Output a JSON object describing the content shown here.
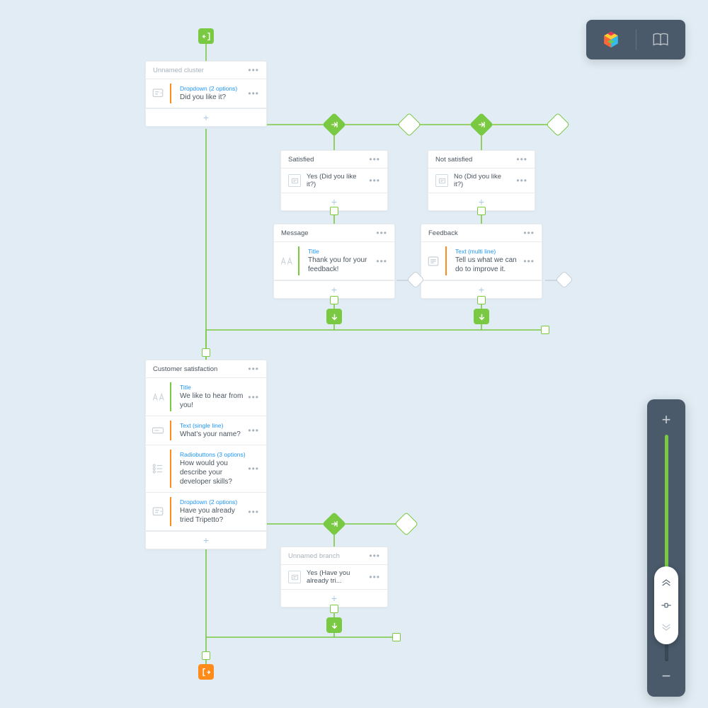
{
  "colors": {
    "green": "#7ac943",
    "orange": "#ff8c1a",
    "blue": "#2196f3",
    "navy": "#4a5a6a",
    "background": "#e1ecf4"
  },
  "clusters": {
    "start": {
      "title": "Unnamed cluster",
      "items": [
        {
          "type": "Dropdown (2 options)",
          "label": "Did you like it?",
          "icon": "dropdown-icon",
          "accent": "orange"
        }
      ]
    },
    "satisfied": {
      "title": "Satisfied",
      "condition": {
        "label": "Yes (Did you like it?)"
      }
    },
    "not_satisfied": {
      "title": "Not satisfied",
      "condition": {
        "label": "No (Did you like it?)"
      }
    },
    "message": {
      "title": "Message",
      "items": [
        {
          "type": "Title",
          "label": "Thank you for your feedback!",
          "icon": "title-icon",
          "accent": "green"
        }
      ]
    },
    "feedback": {
      "title": "Feedback",
      "items": [
        {
          "type": "Text (multi line)",
          "label": "Tell us what we can do to improve it.",
          "icon": "multiline-icon",
          "accent": "orange"
        }
      ]
    },
    "customer": {
      "title": "Customer satisfaction",
      "items": [
        {
          "type": "Title",
          "label": "We like to hear from you!",
          "icon": "title-icon",
          "accent": "green"
        },
        {
          "type": "Text (single line)",
          "label": "What's your name?",
          "icon": "singleline-icon",
          "accent": "orange"
        },
        {
          "type": "Radiobuttons (3 options)",
          "label": "How would you describe your developer skills?",
          "icon": "radio-icon",
          "accent": "orange"
        },
        {
          "type": "Dropdown (2 options)",
          "label": "Have you already tried Tripetto?",
          "icon": "dropdown-icon",
          "accent": "orange"
        }
      ]
    },
    "branch": {
      "title": "Unnamed branch",
      "condition": {
        "label": "Yes (Have you already tri..."
      }
    }
  },
  "toolbar": {
    "logo_name": "tripetto-logo",
    "docs_name": "book-icon"
  },
  "zoom": {
    "fill_percent": 62
  }
}
